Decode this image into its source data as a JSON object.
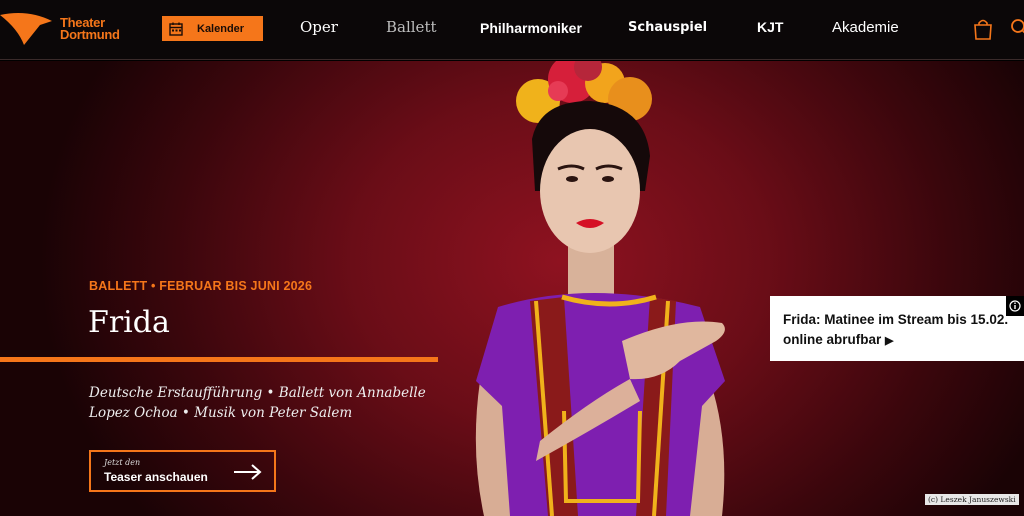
{
  "header": {
    "logo_line1": "Theater",
    "logo_line2": "Dortmund",
    "calendar_label": "Kalender",
    "nav": [
      "Oper",
      "Ballett",
      "Philharmoniker",
      "Schauspiel",
      "KJT",
      "Akademie"
    ]
  },
  "hero": {
    "kicker": "BALLETT • FEBRUAR BIS JUNI 2026",
    "title": "Frida",
    "description": "Deutsche Erstaufführung • Ballett von Annabelle Lopez Ochoa • Musik von Peter Salem",
    "teaser_small": "Jetzt den",
    "teaser_label": "Teaser anschauen",
    "stream_text": "Frida: Matinee im Stream bis 15.02. online abrufbar",
    "stream_arrow": "▶",
    "credit": "(c) Leszek Januszewski"
  },
  "colors": {
    "accent": "#f5761a",
    "background": "#0b0708",
    "hero": "#7a0f1c"
  },
  "icons": [
    "logo-mark-icon",
    "calendar-icon",
    "cart-icon",
    "search-icon",
    "arrow-right-icon",
    "info-icon"
  ]
}
